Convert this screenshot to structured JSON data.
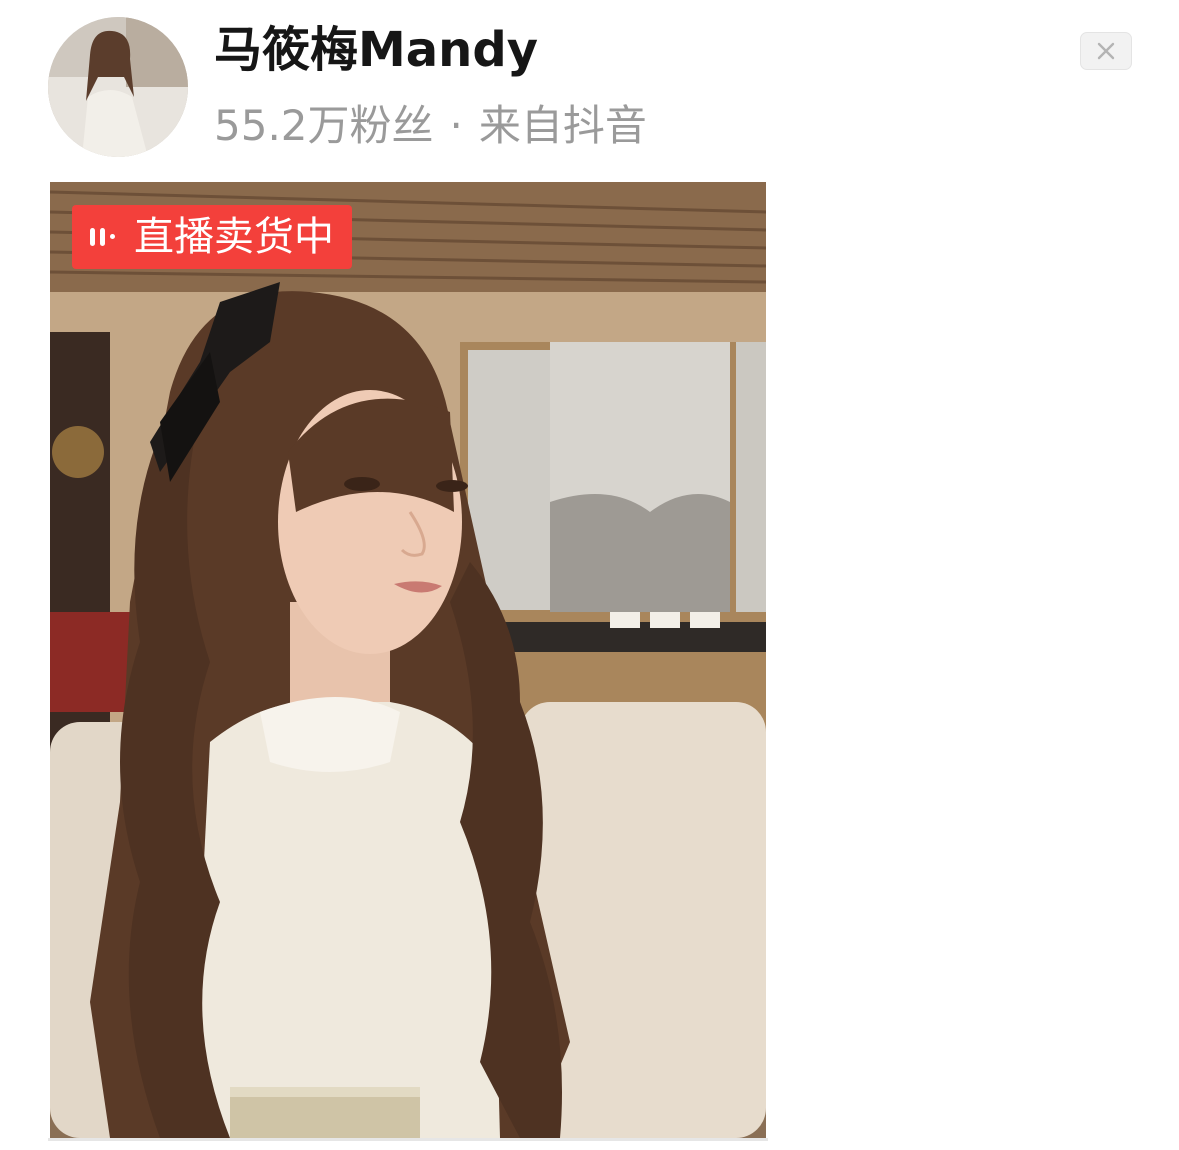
{
  "author": {
    "name": "马筱梅Mandy",
    "followers": "55.2万粉丝",
    "separator": "·",
    "source": "来自抖音"
  },
  "close_button": {
    "icon": "close-icon",
    "label": "×"
  },
  "video": {
    "live_badge": {
      "icon": "live-wave-icon",
      "label": "直播卖货中"
    }
  },
  "colors": {
    "badge": "#f3403b",
    "name": "#161616",
    "meta": "#9a9a9a"
  }
}
